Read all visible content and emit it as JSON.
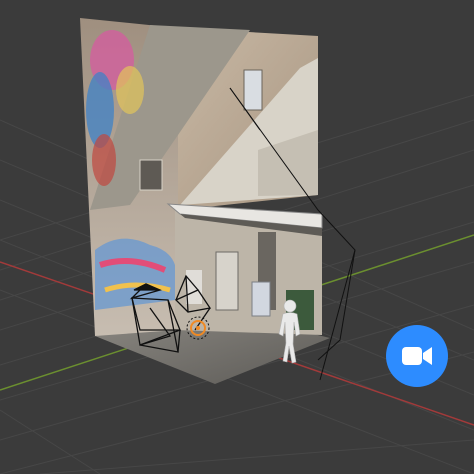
{
  "viewport": {
    "name": "3D Viewport",
    "background": "#3b3b3b",
    "grid_color": "#4a4a4a",
    "x_axis_color": "#a23a3a",
    "y_axis_color": "#6b8f2f"
  },
  "scene": {
    "backdrop_object": "graffiti-alley-photo-backdrop",
    "objects": [
      "wireframe-camera-left",
      "wireframe-camera-right",
      "mannequin-figure",
      "light-gizmo"
    ]
  },
  "camera_button": {
    "icon": "video-camera-icon",
    "color": "#2d8cff"
  }
}
